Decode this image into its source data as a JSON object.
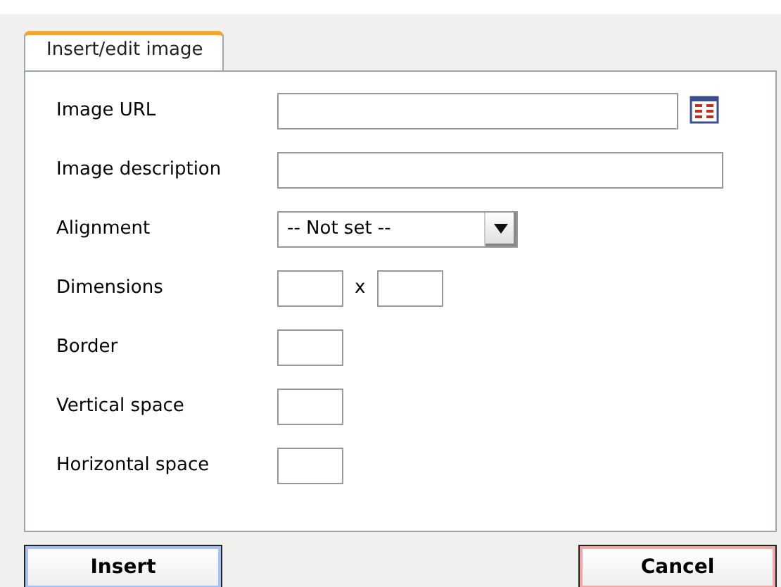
{
  "tabs": [
    {
      "label": "Insert/edit image",
      "selected": true
    }
  ],
  "rows": [
    {
      "label": "Image URL",
      "kind": "browse"
    },
    {
      "label": "Image description",
      "kind": "wide"
    },
    {
      "label": "Alignment",
      "kind": "select",
      "value": "-- Not set --"
    },
    {
      "label": "Dimensions",
      "kind": "pair",
      "separator": "x"
    },
    {
      "label": "Border",
      "kind": "small"
    },
    {
      "label": "Vertical space",
      "kind": "small"
    },
    {
      "label": "Horizontal space",
      "kind": "small"
    }
  ],
  "buttons": [
    {
      "label": "Insert",
      "kind": "primary"
    },
    {
      "label": "Cancel",
      "kind": "cancel"
    }
  ]
}
